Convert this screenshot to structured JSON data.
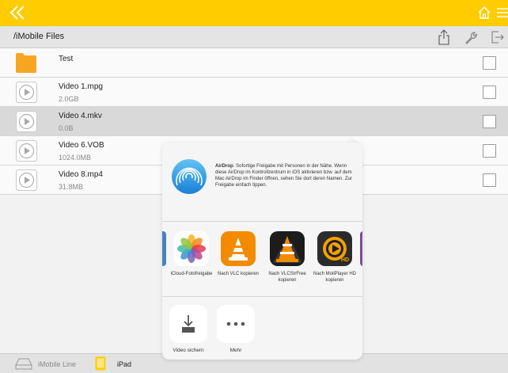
{
  "colors": {
    "accent": "#ffcc00",
    "selected_row": "#d9d9d9",
    "vlc_orange": "#f28b00"
  },
  "topbar": {
    "back_icon": "double-chevron-left-icon",
    "home_icon": "home-icon",
    "menu_icon": "menu-icon"
  },
  "pathbar": {
    "path": "/iMobile Files",
    "icons": [
      "share-icon",
      "wrench-icon",
      "exit-icon"
    ]
  },
  "files": [
    {
      "name": "Test",
      "size": "",
      "type": "folder",
      "selected": false
    },
    {
      "name": "Video 1.mpg",
      "size": "2.0GB",
      "type": "video",
      "selected": false
    },
    {
      "name": "Video 4.mkv",
      "size": "0.0B",
      "type": "video",
      "selected": true
    },
    {
      "name": "Video 6.VOB",
      "size": "1024.0MB",
      "type": "video",
      "selected": false
    },
    {
      "name": "Video 8.mp4",
      "size": "31.8MB",
      "type": "video",
      "selected": false
    }
  ],
  "share_sheet": {
    "airdrop_title": "AirDrop",
    "airdrop_text": ". Sofortige Freigabe mit Personen in der Nähe. Wenn diese AirDrop im Kontrollzentrum in iOS aktivieren bzw. auf dem Mac AirDrop im Finder öffnen, sehen Sie dort deren Namen. Zur Freigabe einfach tippen.",
    "apps": [
      {
        "label": "iCloud-Fotofreigabe",
        "icon": "photos-icon"
      },
      {
        "label": "Nach VLC kopieren",
        "icon": "vlc-icon"
      },
      {
        "label": "Nach VLCStrFree kopieren",
        "icon": "vlcstrfree-icon"
      },
      {
        "label": "Nach MoliPlayer HD kopieren",
        "icon": "moliplayer-icon"
      }
    ],
    "actions": [
      {
        "label": "Video sichern",
        "icon": "save-video-icon"
      },
      {
        "label": "Mehr",
        "icon": "more-icon"
      }
    ]
  },
  "bottombar": {
    "device_1": "iMobile Line",
    "device_2": "iPad"
  }
}
